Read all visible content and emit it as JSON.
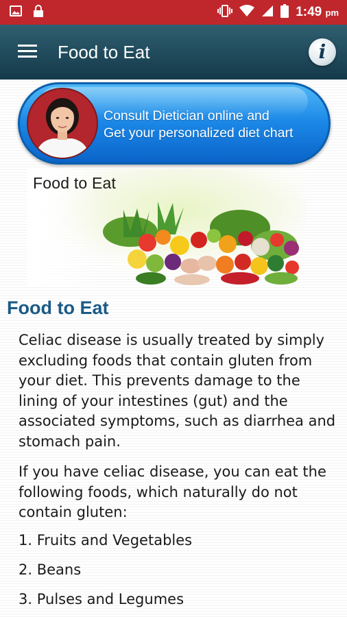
{
  "status_bar": {
    "time": "1:49",
    "ampm": "pm",
    "icons": [
      "image-icon",
      "lock-icon",
      "vibrate-icon",
      "wifi-icon",
      "signal-icon",
      "battery-icon"
    ]
  },
  "app_bar": {
    "title": "Food to Eat",
    "menu_icon": "hamburger-menu-icon",
    "info_icon": "info-icon",
    "info_glyph": "i"
  },
  "banner": {
    "line1": "Consult Dietician online and",
    "line2": "Get your personalized diet chart",
    "avatar": "dietician-avatar"
  },
  "hero_image": {
    "caption": "Food to Eat"
  },
  "article": {
    "heading": "Food to Eat",
    "paragraphs": [
      "Celiac disease is usually treated by simply excluding foods that contain gluten from your diet. This prevents damage to the lining of your intestines (gut) and the associated symptoms, such as diarrhea and stomach pain.",
      "If you have celiac disease, you can eat the following foods, which naturally do not contain gluten:"
    ],
    "list": [
      "1. Fruits and Vegetables",
      "2. Beans",
      "3. Pulses and Legumes"
    ]
  },
  "colors": {
    "status_bar": "#c0272d",
    "app_bar_top": "#2f5f70",
    "app_bar_bottom": "#14394a",
    "banner_blue": "#1a86e6",
    "heading_blue": "#1b5a87"
  }
}
